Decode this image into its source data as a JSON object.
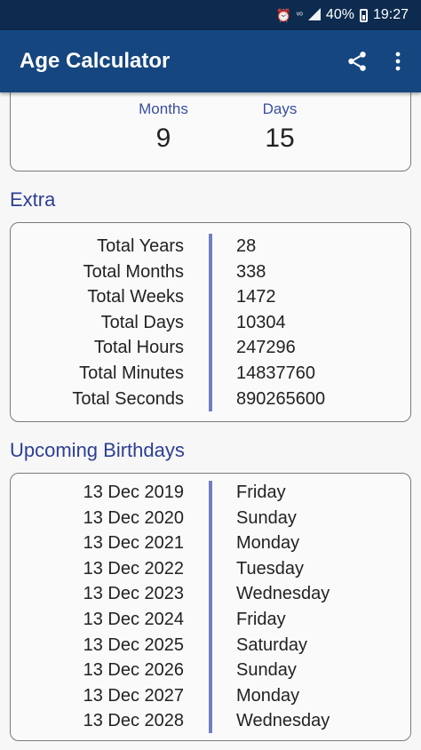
{
  "status_bar": {
    "battery": "40%",
    "time": "19:27",
    "icons": [
      "alarm-icon",
      "volte-icon",
      "signal-icon",
      "battery-icon"
    ]
  },
  "app_bar": {
    "title": "Age Calculator",
    "share_icon": "share-icon",
    "menu_icon": "more-vert-icon"
  },
  "age_summary": {
    "months_label": "Months",
    "months_value": "9",
    "days_label": "Days",
    "days_value": "15"
  },
  "extra": {
    "title": "Extra",
    "rows": [
      {
        "label": "Total Years",
        "value": "28"
      },
      {
        "label": "Total Months",
        "value": "338"
      },
      {
        "label": "Total Weeks",
        "value": "1472"
      },
      {
        "label": "Total Days",
        "value": "10304"
      },
      {
        "label": "Total Hours",
        "value": "247296"
      },
      {
        "label": "Total Minutes",
        "value": "14837760"
      },
      {
        "label": "Total Seconds",
        "value": "890265600"
      }
    ]
  },
  "upcoming": {
    "title": "Upcoming Birthdays",
    "rows": [
      {
        "date": "13 Dec 2019",
        "day": "Friday"
      },
      {
        "date": "13 Dec 2020",
        "day": "Sunday"
      },
      {
        "date": "13 Dec 2021",
        "day": "Monday"
      },
      {
        "date": "13 Dec 2022",
        "day": "Tuesday"
      },
      {
        "date": "13 Dec 2023",
        "day": "Wednesday"
      },
      {
        "date": "13 Dec 2024",
        "day": "Friday"
      },
      {
        "date": "13 Dec 2025",
        "day": "Saturday"
      },
      {
        "date": "13 Dec 2026",
        "day": "Sunday"
      },
      {
        "date": "13 Dec 2027",
        "day": "Monday"
      },
      {
        "date": "13 Dec 2028",
        "day": "Wednesday"
      }
    ]
  },
  "colors": {
    "status_bar": "#0d2a4f",
    "app_bar": "#15467f",
    "accent_text": "#2d3f94",
    "divider": "#6f7fc0"
  }
}
